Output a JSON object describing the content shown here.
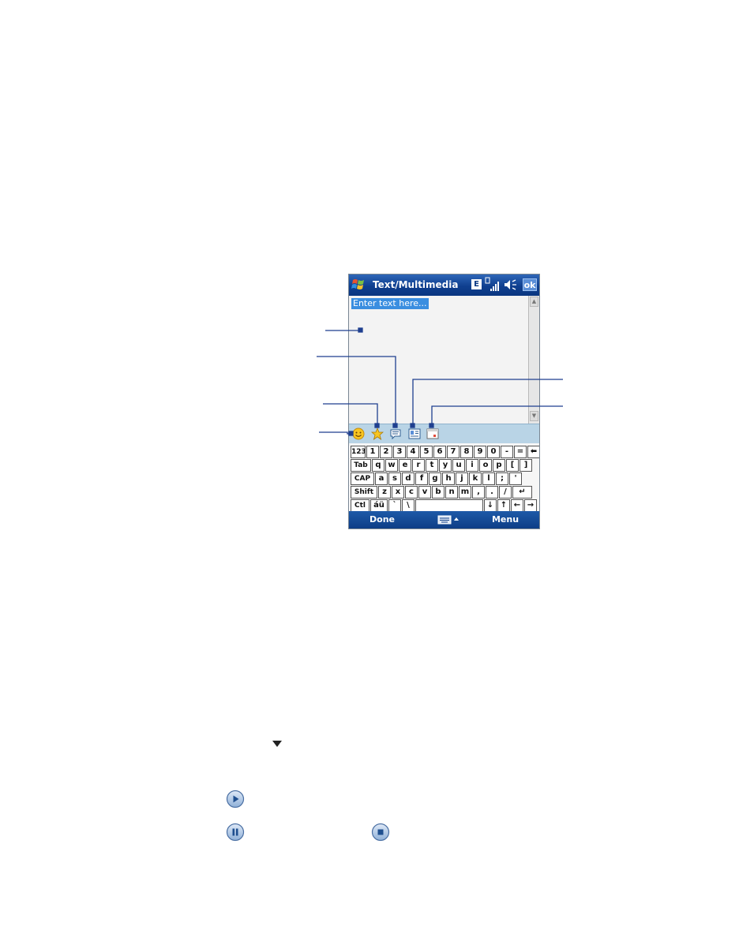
{
  "window": {
    "title": "Text/Multimedia",
    "network_badge": "E",
    "ok_label": "ok"
  },
  "compose": {
    "placeholder": "Enter text here..."
  },
  "toolbar": {
    "icons": [
      "emoticon-icon",
      "star-icon",
      "text-template-icon",
      "contact-card-icon",
      "calendar-icon"
    ]
  },
  "keyboard": {
    "rows": [
      [
        "123",
        "1",
        "2",
        "3",
        "4",
        "5",
        "6",
        "7",
        "8",
        "9",
        "0",
        "-",
        "=",
        "⬅"
      ],
      [
        "Tab",
        "q",
        "w",
        "e",
        "r",
        "t",
        "y",
        "u",
        "i",
        "o",
        "p",
        "[",
        "]"
      ],
      [
        "CAP",
        "a",
        "s",
        "d",
        "f",
        "g",
        "h",
        "j",
        "k",
        "l",
        ";",
        "'"
      ],
      [
        "Shift",
        "z",
        "x",
        "c",
        "v",
        "b",
        "n",
        "m",
        ",",
        ".",
        "/",
        "↵"
      ],
      [
        "Ctl",
        "áü",
        "`",
        "\\",
        "",
        "↓",
        "↑",
        "←",
        "→"
      ]
    ]
  },
  "softkeys": {
    "left": "Done",
    "right": "Menu"
  },
  "colors": {
    "titlebar": "#0f3f8f",
    "toolbar": "#b9d4e6",
    "callout": "#1f3f8f",
    "selection": "#3a8ee0"
  }
}
